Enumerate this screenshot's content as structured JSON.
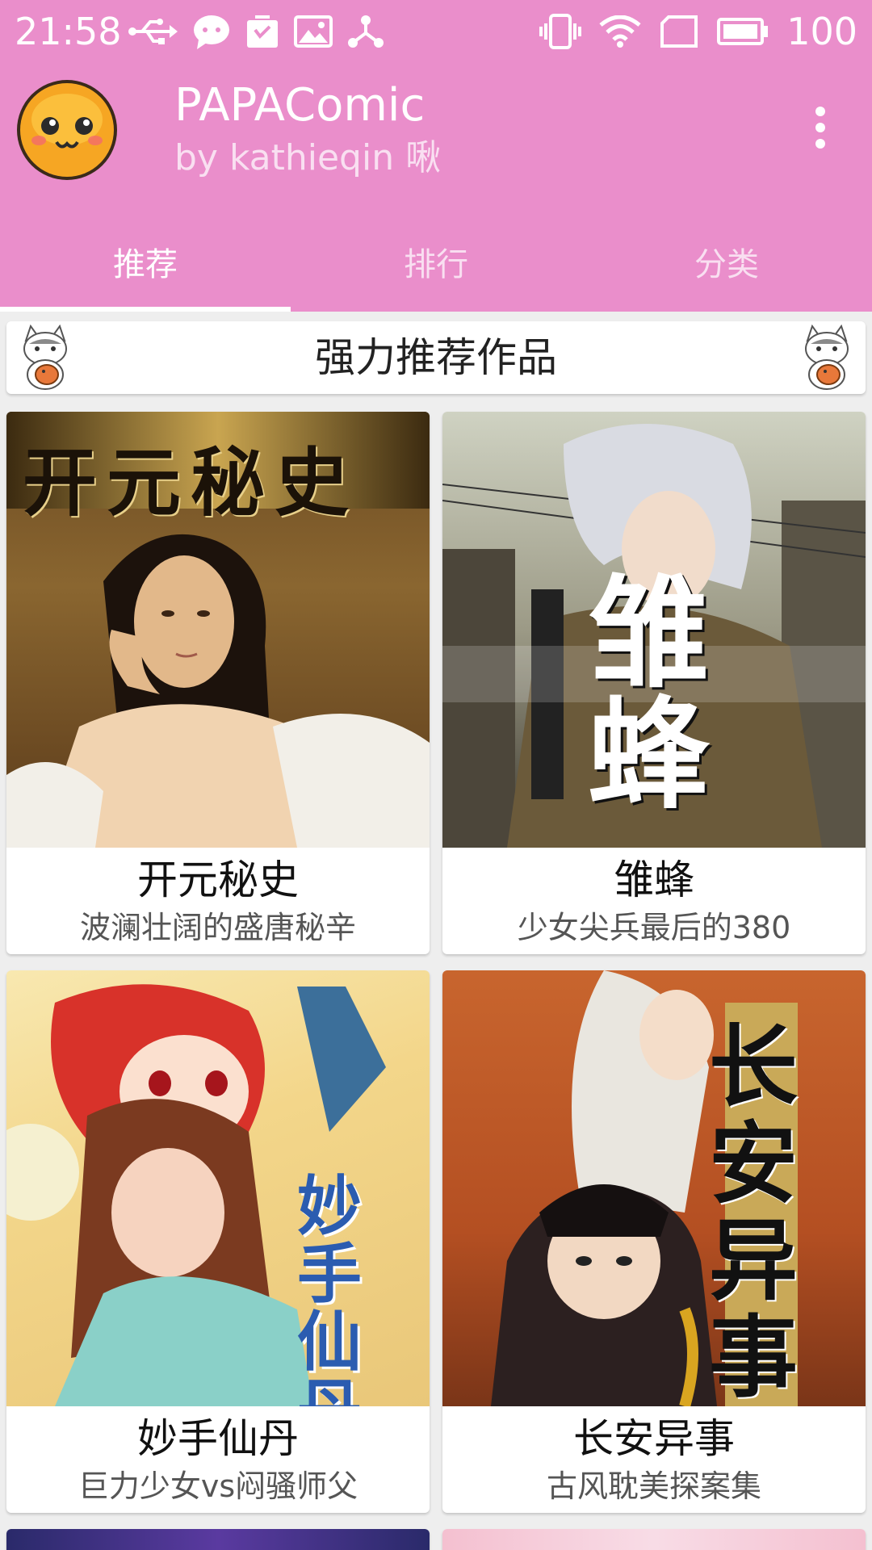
{
  "status_bar": {
    "time": "21:58",
    "battery": "100",
    "left_icons": [
      "usb-icon",
      "chat-icon",
      "bag-icon",
      "image-icon",
      "share-icon"
    ],
    "right_icons": [
      "vibrate-icon",
      "wifi-icon",
      "sim-icon",
      "battery-icon"
    ]
  },
  "toolbar": {
    "title": "PAPAComic",
    "subtitle": "by kathieqin 啾"
  },
  "tabs": [
    {
      "label": "推荐",
      "active": true
    },
    {
      "label": "排行",
      "active": false
    },
    {
      "label": "分类",
      "active": false
    }
  ],
  "section": {
    "title": "强力推荐作品"
  },
  "comics": [
    {
      "name": "开元秘史",
      "desc": "波澜壮阔的盛唐秘辛",
      "cover_text": "开元秘史"
    },
    {
      "name": "雏蜂",
      "desc": "少女尖兵最后的380",
      "cover_text": "雏蜂"
    },
    {
      "name": "妙手仙丹",
      "desc": "巨力少女vs闷骚师父",
      "cover_text": "妙手仙丹"
    },
    {
      "name": "长安异事",
      "desc": "古风耽美探案集",
      "cover_text": "长安异事"
    }
  ],
  "colors": {
    "header": "#ea8ecb",
    "background": "#eeeeee",
    "card": "#ffffff"
  }
}
